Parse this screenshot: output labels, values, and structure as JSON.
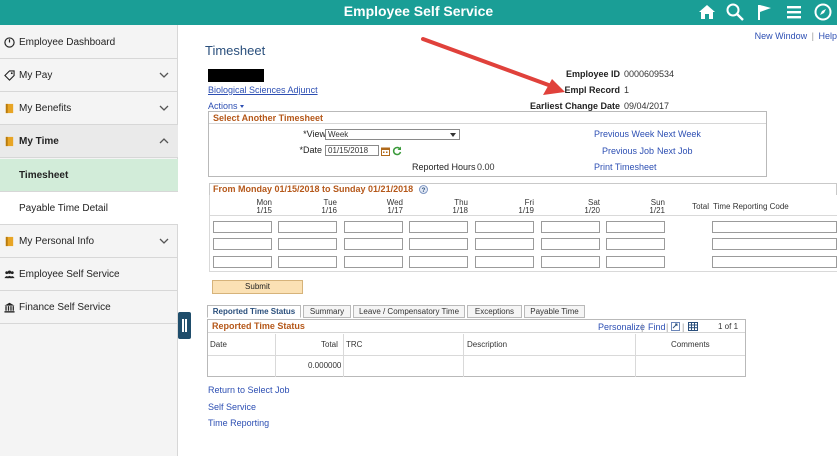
{
  "app": {
    "title": "Employee Self Service"
  },
  "sidebar": {
    "items": [
      {
        "label": "Employee Dashboard"
      },
      {
        "label": "My Pay"
      },
      {
        "label": "My Benefits"
      },
      {
        "label": "My Time"
      },
      {
        "label": "Timesheet"
      },
      {
        "label": "Payable Time Detail"
      },
      {
        "label": "My Personal Info"
      },
      {
        "label": "Employee Self Service"
      },
      {
        "label": "Finance Self Service"
      }
    ]
  },
  "header": {
    "page_title": "Timesheet",
    "new_window": "New Window",
    "separator": "|",
    "help": "Help",
    "department": "Biological Sciences Adjunct",
    "actions": "Actions"
  },
  "employee": {
    "id_label": "Employee ID",
    "id_value": "0000609534",
    "record_label": "Empl Record",
    "record_value": "1",
    "change_label": "Earliest Change Date",
    "change_value": "09/04/2017"
  },
  "select_box": {
    "title": "Select Another Timesheet",
    "view_by_label": "*View By",
    "view_by_value": "Week",
    "date_label": "*Date",
    "date_value": "01/15/2018",
    "reported_hours_label": "Reported Hours",
    "reported_hours_value": "0.00",
    "prev_week": "Previous Week",
    "next_week": "Next Week",
    "prev_job": "Previous Job",
    "next_job": "Next Job",
    "print": "Print Timesheet"
  },
  "week": {
    "title": "From Monday 01/15/2018 to Sunday 01/21/2018",
    "days": [
      {
        "name": "Mon",
        "date": "1/15"
      },
      {
        "name": "Tue",
        "date": "1/16"
      },
      {
        "name": "Wed",
        "date": "1/17"
      },
      {
        "name": "Thu",
        "date": "1/18"
      },
      {
        "name": "Fri",
        "date": "1/19"
      },
      {
        "name": "Sat",
        "date": "1/20"
      },
      {
        "name": "Sun",
        "date": "1/21"
      }
    ],
    "total_label": "Total",
    "trc_label": "Time Reporting Code"
  },
  "submit_label": "Submit",
  "tabs": [
    {
      "label": "Reported Time Status"
    },
    {
      "label": "Summary"
    },
    {
      "label": "Leave / Compensatory Time"
    },
    {
      "label": "Exceptions"
    },
    {
      "label": "Payable Time"
    }
  ],
  "reported_status": {
    "title": "Reported Time Status",
    "personalize": "Personalize",
    "find": "Find",
    "pager": "1 of 1",
    "columns": [
      "Date",
      "Total",
      "TRC",
      "Description",
      "Comments"
    ],
    "total_value": "0.000000"
  },
  "bottom_links": [
    "Return to Select Job",
    "Self Service",
    "Time Reporting"
  ],
  "colors": {
    "topbar": "#1a9e96",
    "active_nav": "#d2ecd9",
    "section_title": "#b5581a",
    "link": "#2d4fb3"
  }
}
